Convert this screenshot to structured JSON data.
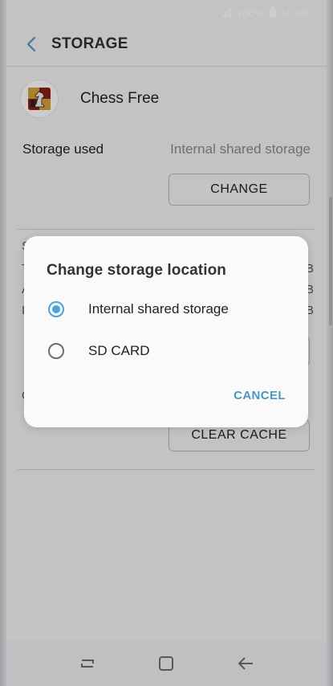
{
  "statusbar": {
    "battery": "100%",
    "time": "10:00"
  },
  "header": {
    "title": "STORAGE"
  },
  "app": {
    "name": "Chess Free"
  },
  "storage": {
    "label": "Storage used",
    "value": "Internal shared storage"
  },
  "buttons": {
    "change": "CHANGE",
    "clear_cache": "CLEAR CACHE"
  },
  "dialog": {
    "title": "Change storage location",
    "options": [
      {
        "label": "Internal shared storage",
        "selected": true
      },
      {
        "label": "SD CARD",
        "selected": false
      }
    ],
    "cancel": "CANCEL"
  },
  "background_fragments": {
    "s": "S",
    "t": "T",
    "a": "A",
    "i": "I",
    "c": "C",
    "b1": "B",
    "b2": "B",
    "b3": "B"
  },
  "colors": {
    "accent": "#4aa3d9",
    "cancel": "#4a98c6"
  },
  "icons": {
    "back": "back-arrow-icon",
    "nav_recent": "recent-apps-icon",
    "nav_home": "home-icon",
    "nav_back": "nav-back-icon"
  }
}
